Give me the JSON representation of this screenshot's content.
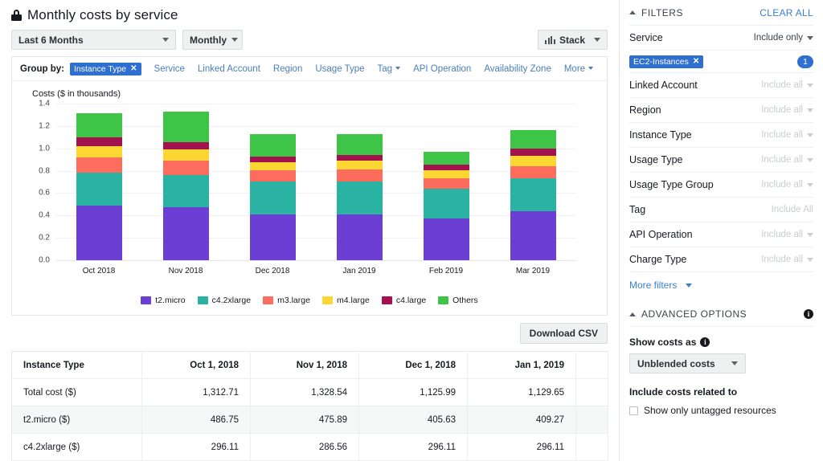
{
  "header": {
    "title": "Monthly costs by service",
    "lock_icon": "lock-icon",
    "date_range": "Last 6 Months",
    "granularity": "Monthly",
    "stack_label": "Stack"
  },
  "group_by": {
    "label": "Group by:",
    "selected_chip": "Instance Type",
    "chip_remove": "✕",
    "options": [
      {
        "label": "Service",
        "caret": false
      },
      {
        "label": "Linked Account",
        "caret": false
      },
      {
        "label": "Region",
        "caret": false
      },
      {
        "label": "Usage Type",
        "caret": false
      },
      {
        "label": "Tag",
        "caret": true
      },
      {
        "label": "API Operation",
        "caret": false
      },
      {
        "label": "Availability Zone",
        "caret": false
      },
      {
        "label": "More",
        "caret": true
      }
    ]
  },
  "chart_data": {
    "type": "bar",
    "stacked": true,
    "title": "Costs ($ in thousands)",
    "ylabel": "Costs ($ in thousands)",
    "xlabel": "",
    "ylim": [
      0,
      1.4
    ],
    "yticks": [
      "1.4",
      "1.2",
      "1.0",
      "0.8",
      "0.6",
      "0.4",
      "0.2",
      "0.0"
    ],
    "grid": true,
    "legend_position": "bottom",
    "categories": [
      "Oct 2018",
      "Nov 2018",
      "Dec 2018",
      "Jan 2019",
      "Feb 2019",
      "Mar 2019"
    ],
    "series": [
      {
        "name": "t2.micro",
        "color": "#6b3fd4",
        "values": [
          0.487,
          0.476,
          0.406,
          0.409,
          0.372,
          0.436
        ]
      },
      {
        "name": "c4.2xlarge",
        "color": "#2ab3a3",
        "values": [
          0.296,
          0.287,
          0.296,
          0.296,
          0.268,
          0.296
        ]
      },
      {
        "name": "m3.large",
        "color": "#fc6d5d",
        "values": [
          0.135,
          0.128,
          0.1,
          0.103,
          0.093,
          0.11
        ]
      },
      {
        "name": "m4.large",
        "color": "#fcd633",
        "values": [
          0.103,
          0.098,
          0.075,
          0.08,
          0.072,
          0.092
        ]
      },
      {
        "name": "c4.large",
        "color": "#a3114f",
        "values": [
          0.075,
          0.067,
          0.05,
          0.052,
          0.049,
          0.061
        ]
      },
      {
        "name": "Others",
        "color": "#3ec548",
        "values": [
          0.217,
          0.273,
          0.199,
          0.19,
          0.116,
          0.166
        ]
      }
    ],
    "totals": [
      1.313,
      1.329,
      1.126,
      1.13,
      0.97,
      1.161
    ]
  },
  "table": {
    "download_label": "Download CSV",
    "columns": [
      "Instance Type",
      "Oct 1, 2018",
      "Nov 1, 2018",
      "Dec 1, 2018",
      "Jan 1, 2019",
      ""
    ],
    "rows": [
      {
        "label": "Total cost ($)",
        "values": [
          "1,312.71",
          "1,328.54",
          "1,125.99",
          "1,129.65",
          ""
        ]
      },
      {
        "label": "t2.micro ($)",
        "values": [
          "486.75",
          "475.89",
          "405.63",
          "409.27",
          ""
        ]
      },
      {
        "label": "c4.2xlarge ($)",
        "values": [
          "296.11",
          "286.56",
          "296.11",
          "296.11",
          ""
        ]
      }
    ]
  },
  "filters": {
    "title": "FILTERS",
    "clear_all": "CLEAR ALL",
    "rows": [
      {
        "name": "Service",
        "value": "Include only",
        "muted": false,
        "caret": true
      },
      {
        "name": "Linked Account",
        "value": "Include all",
        "muted": true,
        "caret": true
      },
      {
        "name": "Region",
        "value": "Include all",
        "muted": true,
        "caret": true
      },
      {
        "name": "Instance Type",
        "value": "Include all",
        "muted": true,
        "caret": true
      },
      {
        "name": "Usage Type",
        "value": "Include all",
        "muted": true,
        "caret": true
      },
      {
        "name": "Usage Type Group",
        "value": "Include all",
        "muted": true,
        "caret": true
      },
      {
        "name": "Tag",
        "value": "Include All",
        "muted": true,
        "caret": false
      },
      {
        "name": "API Operation",
        "value": "Include all",
        "muted": true,
        "caret": true
      },
      {
        "name": "Charge Type",
        "value": "Include all",
        "muted": true,
        "caret": true
      }
    ],
    "service_chip": "EC2-Instances",
    "service_chip_remove": "✕",
    "service_count": "1",
    "more_filters": "More filters",
    "accent_color": "#2f6fd0",
    "link_color": "#3b7fd4"
  },
  "advanced": {
    "title": "ADVANCED OPTIONS",
    "info_icon": "info-icon",
    "show_costs_label": "Show costs as",
    "show_costs_value": "Unblended costs",
    "include_label": "Include costs related to",
    "checkbox_label": "Show only untagged resources"
  }
}
